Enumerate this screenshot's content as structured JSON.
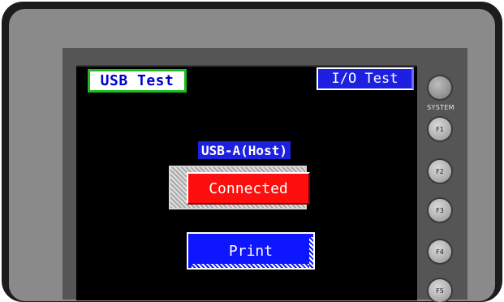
{
  "tabs": {
    "usb_test": "USB Test",
    "io_test": "I/O Test"
  },
  "usb_a": {
    "label": "USB-A(Host)",
    "status": "Connected"
  },
  "print_label": "Print",
  "hardware": {
    "system_label": "SYSTEM",
    "fkeys": [
      "F1",
      "F2",
      "F3",
      "F4",
      "F5"
    ]
  },
  "colors": {
    "tab_active_border": "#22bb22",
    "tab_text": "#0000cc",
    "label_bg": "#1d20e0",
    "status_bg": "#ff0e0e",
    "print_bg": "#0e15ff"
  }
}
